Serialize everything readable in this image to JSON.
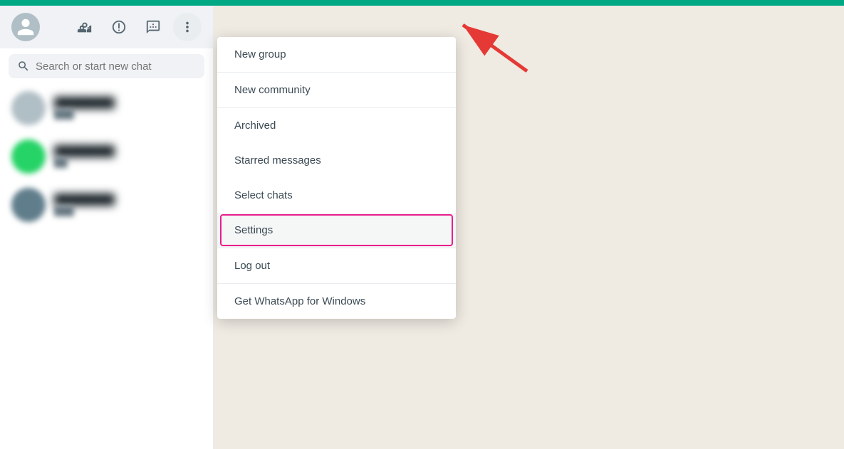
{
  "topBar": {
    "color": "#00a884"
  },
  "sidebar": {
    "header": {
      "icons": [
        {
          "name": "new-group-icon",
          "symbol": "👥"
        },
        {
          "name": "status-icon",
          "symbol": "⊙"
        },
        {
          "name": "chat-icon",
          "symbol": "💬"
        },
        {
          "name": "new-chat-icon",
          "symbol": "✎"
        }
      ],
      "moreLabel": "⋮"
    },
    "search": {
      "placeholder": "Search or start new chat"
    },
    "chats": [
      {
        "name": "Chat 1",
        "preview": "message preview",
        "avatarType": "gray"
      },
      {
        "name": "Chat 2",
        "preview": "message preview",
        "avatarType": "green"
      },
      {
        "name": "Chat 3",
        "preview": "message preview",
        "avatarType": "dark"
      }
    ]
  },
  "menu": {
    "items": [
      {
        "id": "new-group",
        "label": "New group",
        "divider": false
      },
      {
        "id": "new-community",
        "label": "New community",
        "divider": true
      },
      {
        "id": "archived",
        "label": "Archived",
        "divider": false
      },
      {
        "id": "starred-messages",
        "label": "Starred messages",
        "divider": false
      },
      {
        "id": "select-chats",
        "label": "Select chats",
        "divider": false
      },
      {
        "id": "settings",
        "label": "Settings",
        "highlighted": true,
        "divider": true
      },
      {
        "id": "log-out",
        "label": "Log out",
        "divider": true
      },
      {
        "id": "get-whatsapp-windows",
        "label": "Get WhatsApp for Windows",
        "divider": false
      }
    ]
  }
}
